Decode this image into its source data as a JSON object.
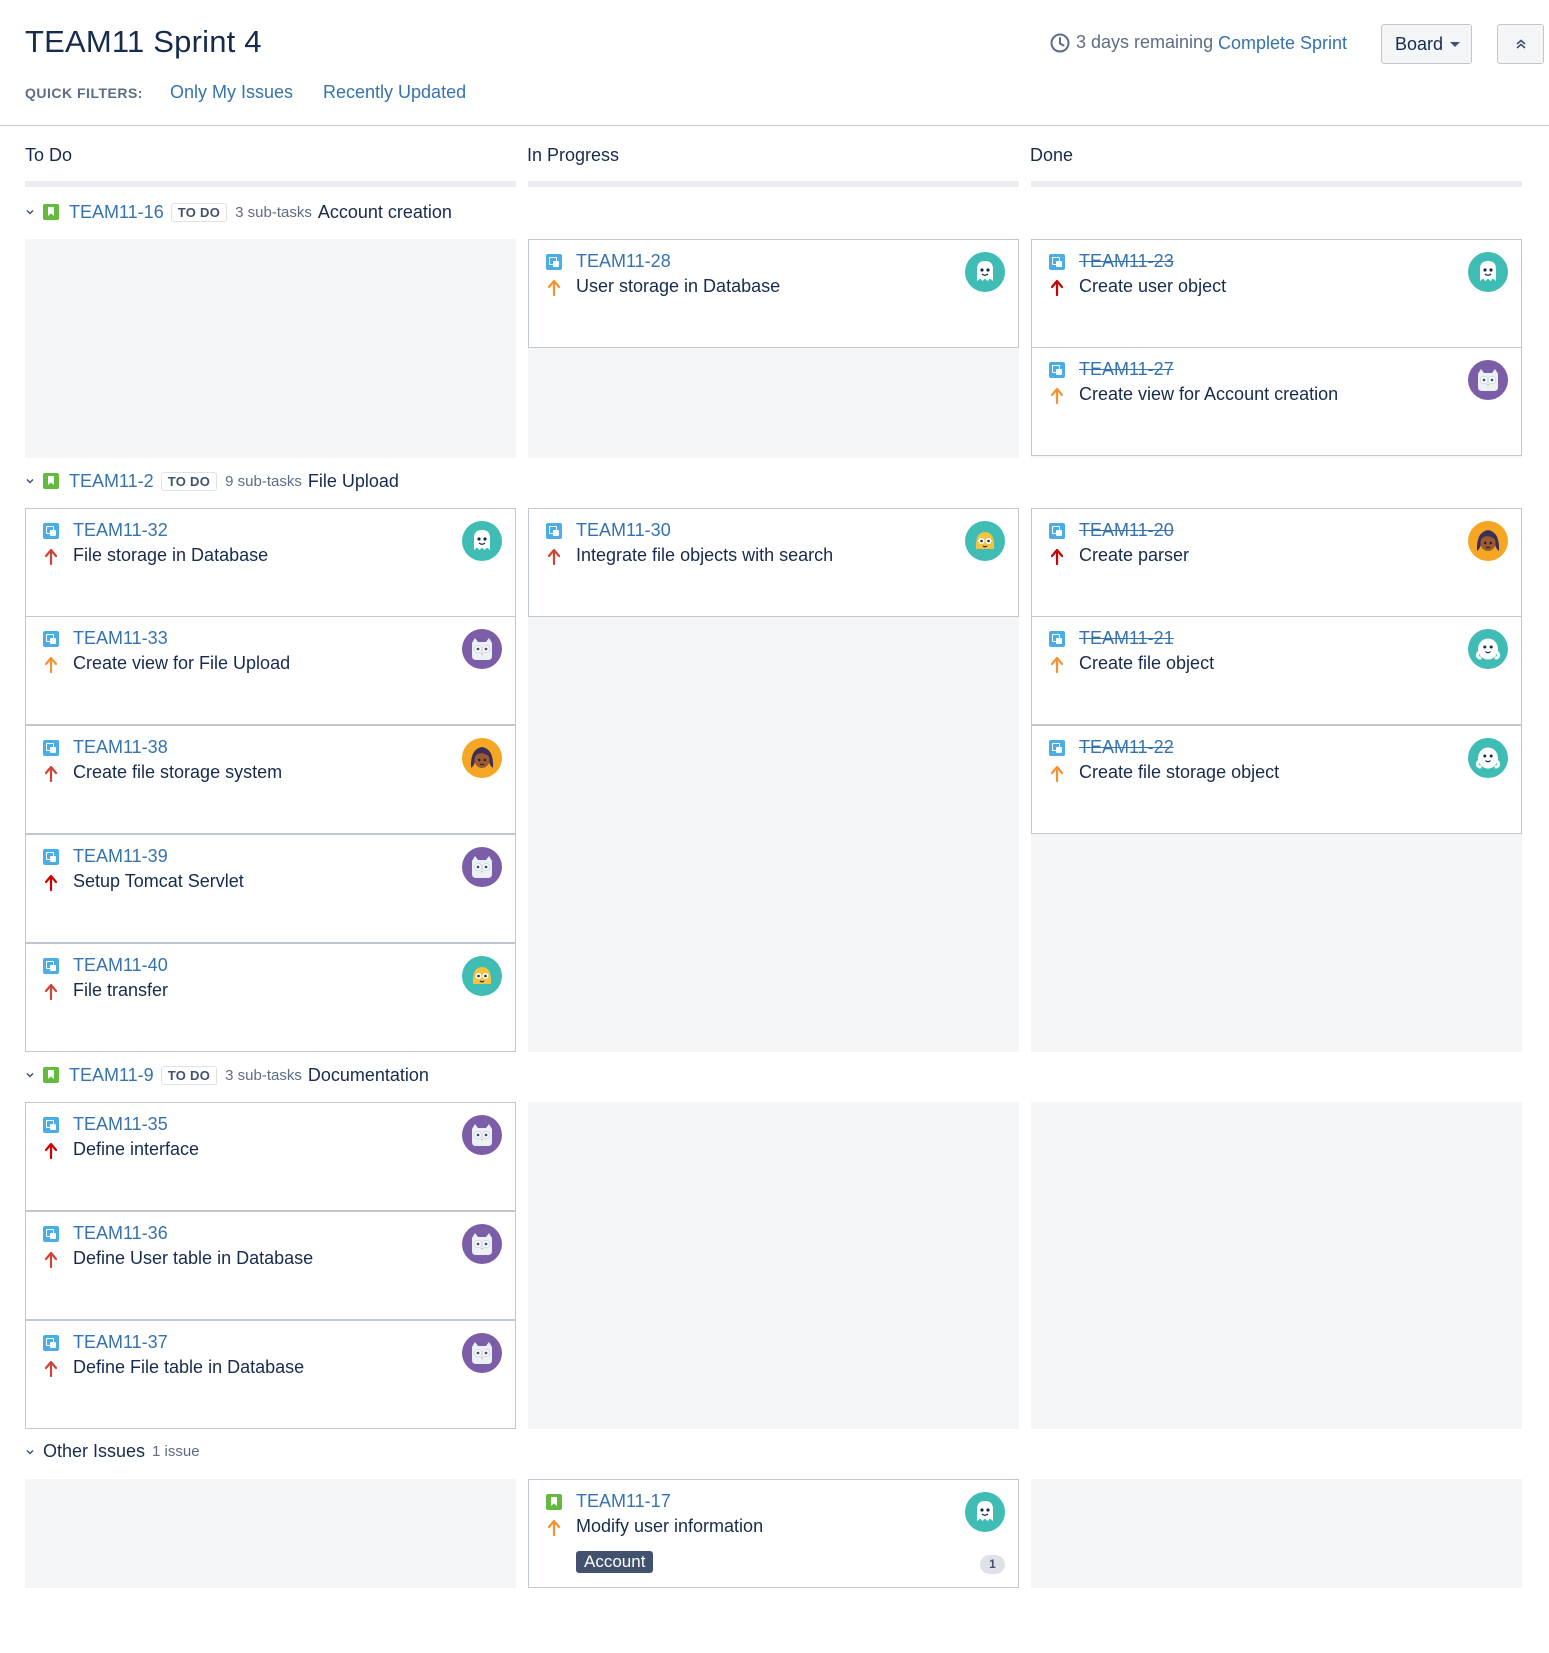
{
  "header": {
    "title": "TEAM11 Sprint 4",
    "quick_filters_label": "QUICK FILTERS:",
    "quick_filters": [
      "Only My Issues",
      "Recently Updated"
    ],
    "remaining": "3 days remaining",
    "complete_sprint": "Complete Sprint",
    "board_button": "Board"
  },
  "columns": [
    "To Do",
    "In Progress",
    "Done"
  ],
  "lanes": [
    {
      "key": "TEAM11-16",
      "status": "TO DO",
      "subtasks": "3 sub-tasks",
      "name": "Account creation"
    },
    {
      "key": "TEAM11-2",
      "status": "TO DO",
      "subtasks": "9 sub-tasks",
      "name": "File Upload"
    },
    {
      "key": "TEAM11-9",
      "status": "TO DO",
      "subtasks": "3 sub-tasks",
      "name": "Documentation"
    }
  ],
  "other": {
    "name": "Other Issues",
    "count": "1 issue"
  },
  "cards": {
    "c28": {
      "key": "TEAM11-28",
      "summary": "User storage in Database"
    },
    "c23": {
      "key": "TEAM11-23",
      "summary": "Create user object"
    },
    "c27": {
      "key": "TEAM11-27",
      "summary": "Create view for Account creation"
    },
    "c32": {
      "key": "TEAM11-32",
      "summary": "File storage in Database"
    },
    "c33": {
      "key": "TEAM11-33",
      "summary": "Create view for File Upload"
    },
    "c38": {
      "key": "TEAM11-38",
      "summary": "Create file storage system"
    },
    "c39": {
      "key": "TEAM11-39",
      "summary": "Setup Tomcat Servlet"
    },
    "c40": {
      "key": "TEAM11-40",
      "summary": "File transfer"
    },
    "c30": {
      "key": "TEAM11-30",
      "summary": "Integrate file objects with search"
    },
    "c20": {
      "key": "TEAM11-20",
      "summary": "Create parser"
    },
    "c21": {
      "key": "TEAM11-21",
      "summary": "Create file object"
    },
    "c22": {
      "key": "TEAM11-22",
      "summary": "Create file storage object"
    },
    "c35": {
      "key": "TEAM11-35",
      "summary": "Define interface"
    },
    "c36": {
      "key": "TEAM11-36",
      "summary": "Define User table in Database"
    },
    "c37": {
      "key": "TEAM11-37",
      "summary": "Define File table in Database"
    },
    "c17": {
      "key": "TEAM11-17",
      "summary": "Modify user information",
      "label": "Account",
      "count": "1"
    }
  },
  "colors": {
    "link": "#3572b0",
    "priority_high": "#d04437",
    "priority_highest": "#ce0000",
    "priority_medium": "#f79232",
    "avatar_teal": "#3fbdb5",
    "avatar_purple": "#7b5ea7",
    "avatar_yellow": "#f5a623"
  },
  "icons": [
    "clock-icon",
    "caret-down-icon",
    "collapse-icon",
    "chevron-down-icon",
    "story-icon",
    "subtask-icon",
    "priority-arrow-icon",
    "avatar"
  ]
}
